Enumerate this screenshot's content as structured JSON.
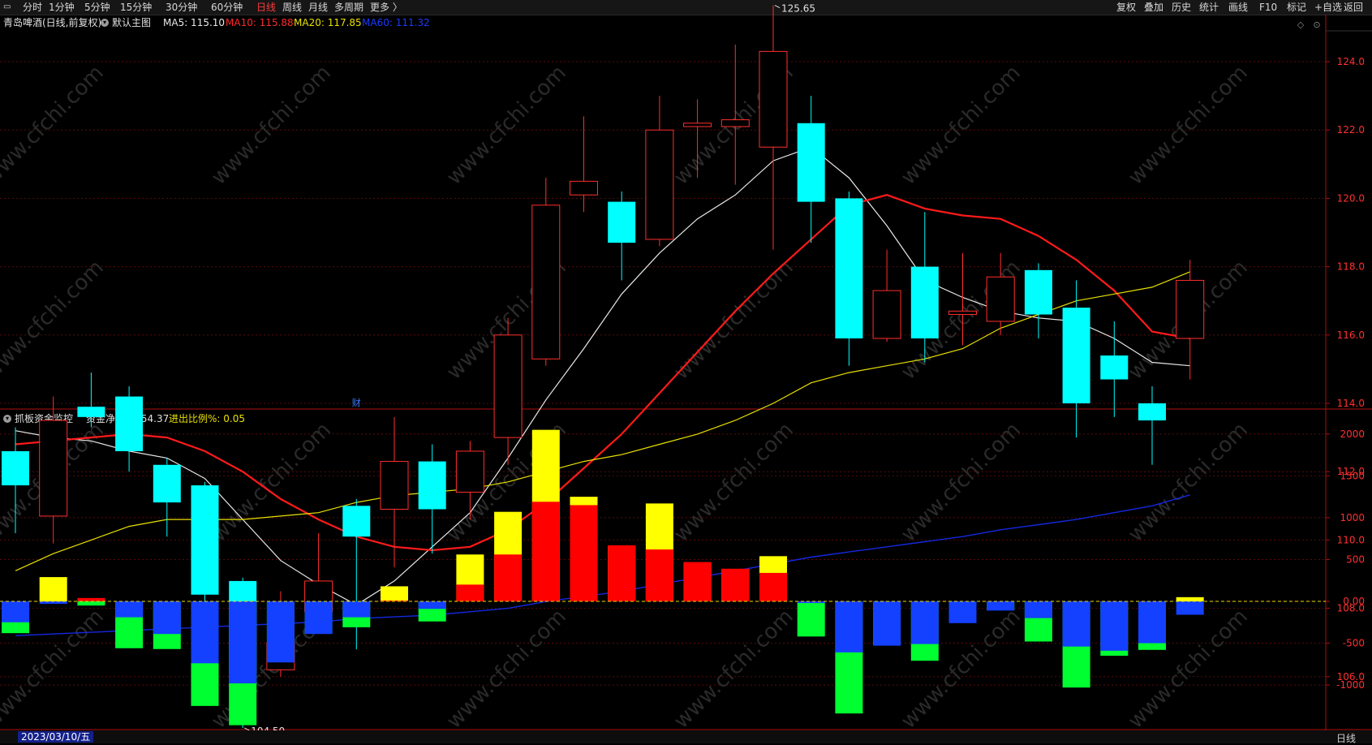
{
  "toolbar": {
    "left_tabs": [
      "分时",
      "1分钟",
      "5分钟",
      "15分钟",
      "30分钟",
      "60分钟",
      "日线",
      "周线",
      "月线",
      "多周期",
      "更多 〉"
    ],
    "active_tab": "日线",
    "right_buttons": [
      "复权",
      "叠加",
      "历史",
      "统计",
      "画线",
      "F10",
      "标记",
      "+自选",
      "返回"
    ]
  },
  "info": {
    "stock": "青岛啤酒(日线,前复权)",
    "main_chart": "默认主图",
    "ma5": "MA5: 115.10",
    "ma10": "MA10: 115.88",
    "ma20": "MA20: 117.85",
    "ma60": "MA60: 111.32"
  },
  "indicator_info": {
    "name": "抓板资金监控",
    "net_flow": "资金净进出: 54.37",
    "ratio": "进出比例%: 0.05"
  },
  "annotations": {
    "high": "125.65",
    "low": "104.50",
    "event_marker": "财",
    "bottom_marker": "4"
  },
  "bottom": {
    "date": "2023/03/10/五",
    "period": "日线"
  },
  "watermark": "www.cfchi.com",
  "colors": {
    "up": "#ff2e2e",
    "down": "#00ffff",
    "ma5": "#e8e8e8",
    "ma10": "#ff1a1a",
    "ma20": "#e8e000",
    "ma60": "#1428e0",
    "bar_red": "#ff0000",
    "bar_yellow": "#ffff00",
    "bar_blue": "#1440ff",
    "bar_green": "#00ff30"
  },
  "chart_data": [
    {
      "type": "candlestick",
      "ylim": [
        105,
        126
      ],
      "y_ticks": [
        "124.0",
        "122.0",
        "120.0",
        "118.0",
        "116.0",
        "114.0",
        "112.0",
        "110.0",
        "108.0",
        "106.0"
      ],
      "candles": [
        {
          "o": 112.6,
          "h": 113.3,
          "l": 110.2,
          "c": 111.6
        },
        {
          "o": 110.7,
          "h": 114.2,
          "l": 109.9,
          "c": 113.5
        },
        {
          "o": 113.9,
          "h": 114.9,
          "l": 113.3,
          "c": 113.6
        },
        {
          "o": 114.2,
          "h": 114.5,
          "l": 112.0,
          "c": 112.6
        },
        {
          "o": 112.2,
          "h": 112.4,
          "l": 110.1,
          "c": 111.1
        },
        {
          "o": 111.6,
          "h": 111.7,
          "l": 108.1,
          "c": 108.4
        },
        {
          "o": 108.8,
          "h": 108.9,
          "l": 104.5,
          "c": 106.1
        },
        {
          "o": 106.2,
          "h": 108.5,
          "l": 106.0,
          "c": 107.0
        },
        {
          "o": 107.9,
          "h": 110.2,
          "l": 107.3,
          "c": 108.8
        },
        {
          "o": 111.0,
          "h": 111.2,
          "l": 106.8,
          "c": 110.1
        },
        {
          "o": 110.9,
          "h": 113.6,
          "l": 109.2,
          "c": 112.3
        },
        {
          "o": 112.3,
          "h": 112.8,
          "l": 109.6,
          "c": 110.9
        },
        {
          "o": 111.4,
          "h": 112.9,
          "l": 110.6,
          "c": 112.6
        },
        {
          "o": 113.0,
          "h": 116.5,
          "l": 112.2,
          "c": 116.0
        },
        {
          "o": 115.3,
          "h": 120.6,
          "l": 115.1,
          "c": 119.8
        },
        {
          "o": 120.1,
          "h": 122.4,
          "l": 119.6,
          "c": 120.5
        },
        {
          "o": 119.9,
          "h": 120.2,
          "l": 117.6,
          "c": 118.7
        },
        {
          "o": 118.8,
          "h": 123.0,
          "l": 118.6,
          "c": 122.0
        },
        {
          "o": 122.1,
          "h": 122.9,
          "l": 120.6,
          "c": 122.2
        },
        {
          "o": 122.1,
          "h": 124.5,
          "l": 120.4,
          "c": 122.3
        },
        {
          "o": 121.5,
          "h": 125.65,
          "l": 118.5,
          "c": 124.3
        },
        {
          "o": 122.2,
          "h": 123.0,
          "l": 118.7,
          "c": 119.9
        },
        {
          "o": 120.0,
          "h": 120.2,
          "l": 115.1,
          "c": 115.9
        },
        {
          "o": 115.9,
          "h": 118.5,
          "l": 115.8,
          "c": 117.3
        },
        {
          "o": 118.0,
          "h": 119.6,
          "l": 115.2,
          "c": 115.9
        },
        {
          "o": 116.6,
          "h": 118.4,
          "l": 115.7,
          "c": 116.7
        },
        {
          "o": 116.4,
          "h": 118.4,
          "l": 116.0,
          "c": 117.7
        },
        {
          "o": 117.9,
          "h": 118.1,
          "l": 115.9,
          "c": 116.6
        },
        {
          "o": 116.8,
          "h": 117.6,
          "l": 113.0,
          "c": 114.0
        },
        {
          "o": 115.4,
          "h": 116.4,
          "l": 113.6,
          "c": 114.7
        },
        {
          "o": 114.0,
          "h": 114.5,
          "l": 112.2,
          "c": 113.5
        },
        {
          "o": 115.9,
          "h": 118.2,
          "l": 114.7,
          "c": 117.6
        }
      ],
      "series": [
        {
          "name": "MA5",
          "values": [
            113.2,
            113.0,
            112.9,
            112.6,
            112.4,
            111.8,
            110.6,
            109.4,
            108.7,
            108.1,
            108.8,
            109.8,
            110.8,
            112.4,
            114.1,
            115.6,
            117.2,
            118.4,
            119.4,
            120.1,
            121.1,
            121.5,
            120.6,
            119.2,
            117.6,
            117.1,
            116.7,
            116.5,
            116.4,
            115.9,
            115.2,
            115.1
          ]
        },
        {
          "name": "MA10",
          "values": [
            112.8,
            112.9,
            113.0,
            113.1,
            113.0,
            112.6,
            112.0,
            111.2,
            110.6,
            110.1,
            109.8,
            109.7,
            109.8,
            110.3,
            111.1,
            112.1,
            113.1,
            114.3,
            115.5,
            116.7,
            117.8,
            118.8,
            119.8,
            120.1,
            119.7,
            119.5,
            119.4,
            118.9,
            118.2,
            117.3,
            116.1,
            115.9
          ]
        },
        {
          "name": "MA20",
          "values": [
            109.1,
            109.6,
            110.0,
            110.4,
            110.6,
            110.6,
            110.6,
            110.7,
            110.8,
            111.1,
            111.3,
            111.4,
            111.5,
            111.7,
            112.0,
            112.3,
            112.5,
            112.8,
            113.1,
            113.5,
            114.0,
            114.6,
            114.9,
            115.1,
            115.3,
            115.6,
            116.2,
            116.6,
            117.0,
            117.2,
            117.4,
            117.85
          ]
        },
        {
          "name": "MA60",
          "values": [
            107.2,
            107.25,
            107.3,
            107.35,
            107.4,
            107.45,
            107.5,
            107.55,
            107.6,
            107.7,
            107.75,
            107.8,
            107.9,
            108.0,
            108.2,
            108.35,
            108.5,
            108.7,
            108.9,
            109.1,
            109.3,
            109.5,
            109.65,
            109.8,
            109.95,
            110.1,
            110.3,
            110.45,
            110.6,
            110.8,
            111.0,
            111.32
          ]
        }
      ]
    },
    {
      "type": "stacked_bar",
      "ylim": [
        -1480,
        2050
      ],
      "y_ticks": [
        "2000",
        "1500",
        "1000",
        "500",
        "0.00",
        "-500",
        "-1000"
      ],
      "bars": [
        {
          "inner": -250,
          "inner_color": "blue",
          "outer": -380,
          "outer_color": "green"
        },
        {
          "inner": -30,
          "inner_color": "blue",
          "outer": 290,
          "outer_color": "yellow"
        },
        {
          "inner": 40,
          "inner_color": "red",
          "outer": -50,
          "outer_color": "green"
        },
        {
          "inner": -190,
          "inner_color": "blue",
          "outer": -560,
          "outer_color": "green"
        },
        {
          "inner": -390,
          "inner_color": "blue",
          "outer": -570,
          "outer_color": "green"
        },
        {
          "inner": -740,
          "inner_color": "blue",
          "outer": -1250,
          "outer_color": "green"
        },
        {
          "inner": -980,
          "inner_color": "blue",
          "outer": -1480,
          "outer_color": "green"
        },
        {
          "inner": -730,
          "inner_color": "blue",
          "outer": -720,
          "outer_color": "green"
        },
        {
          "inner": -390,
          "inner_color": "blue",
          "outer": -385,
          "outer_color": "green"
        },
        {
          "inner": -190,
          "inner_color": "blue",
          "outer": -310,
          "outer_color": "green"
        },
        {
          "inner": 10,
          "inner_color": "red",
          "outer": 180,
          "outer_color": "yellow"
        },
        {
          "inner": -90,
          "inner_color": "blue",
          "outer": -240,
          "outer_color": "green"
        },
        {
          "inner": 200,
          "inner_color": "red",
          "outer": 560,
          "outer_color": "yellow"
        },
        {
          "inner": 560,
          "inner_color": "red",
          "outer": 1070,
          "outer_color": "yellow"
        },
        {
          "inner": 1190,
          "inner_color": "red",
          "outer": 2050,
          "outer_color": "yellow"
        },
        {
          "inner": 1150,
          "inner_color": "red",
          "outer": 1250,
          "outer_color": "yellow"
        },
        {
          "inner": 670,
          "inner_color": "red",
          "outer": 665,
          "outer_color": "yellow"
        },
        {
          "inner": 620,
          "inner_color": "red",
          "outer": 1170,
          "outer_color": "yellow"
        },
        {
          "inner": 470,
          "inner_color": "red",
          "outer": 465,
          "outer_color": "yellow"
        },
        {
          "inner": 390,
          "inner_color": "red",
          "outer": 385,
          "outer_color": "yellow"
        },
        {
          "inner": 340,
          "inner_color": "red",
          "outer": 540,
          "outer_color": "yellow"
        },
        {
          "inner": -20,
          "inner_color": "blue",
          "outer": -420,
          "outer_color": "green"
        },
        {
          "inner": -610,
          "inner_color": "blue",
          "outer": -1340,
          "outer_color": "green"
        },
        {
          "inner": -530,
          "inner_color": "blue",
          "outer": -525,
          "outer_color": "green"
        },
        {
          "inner": -510,
          "inner_color": "blue",
          "outer": -710,
          "outer_color": "green"
        },
        {
          "inner": -260,
          "inner_color": "blue",
          "outer": -255,
          "outer_color": "green"
        },
        {
          "inner": -110,
          "inner_color": "blue",
          "outer": -105,
          "outer_color": "green"
        },
        {
          "inner": -200,
          "inner_color": "blue",
          "outer": -480,
          "outer_color": "green"
        },
        {
          "inner": -540,
          "inner_color": "blue",
          "outer": -1030,
          "outer_color": "green"
        },
        {
          "inner": -590,
          "inner_color": "blue",
          "outer": -650,
          "outer_color": "green"
        },
        {
          "inner": -500,
          "inner_color": "blue",
          "outer": -580,
          "outer_color": "green"
        },
        {
          "inner": -160,
          "inner_color": "blue",
          "outer": 50,
          "outer_color": "yellow"
        }
      ]
    }
  ]
}
